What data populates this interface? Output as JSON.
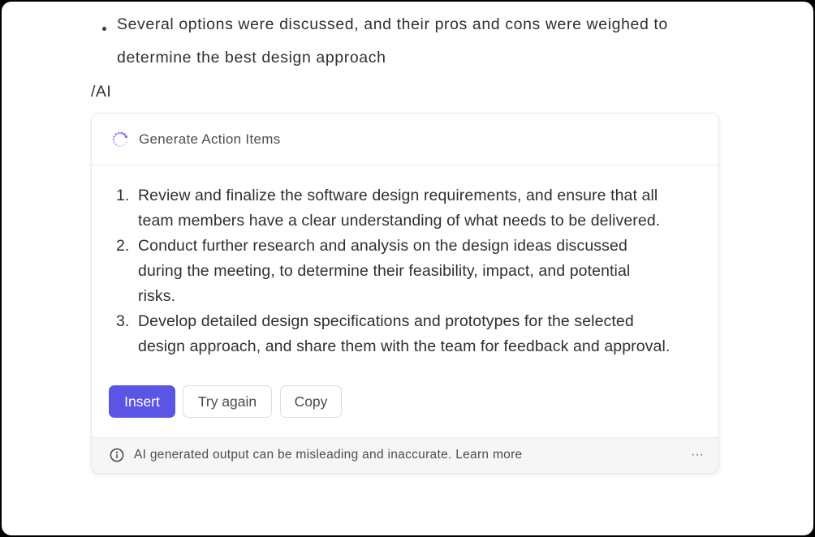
{
  "document": {
    "bullet_line_1": "Several options were discussed, and their pros and cons were weighed to",
    "bullet_line_2": "determine the best design approach",
    "ai_command": "/AI"
  },
  "ai_panel": {
    "title": "Generate Action Items",
    "items": [
      {
        "number": "1.",
        "lines": [
          "Review and finalize the software design requirements, and ensure that all",
          "team members have a clear understanding of what needs to be delivered."
        ]
      },
      {
        "number": "2.",
        "lines": [
          "Conduct further research and analysis on the design ideas discussed",
          "during the meeting, to determine their feasibility, impact, and potential",
          "risks."
        ]
      },
      {
        "number": "3.",
        "lines": [
          "Develop detailed design specifications and prototypes for the selected",
          "design approach, and share them with the team for feedback and approval."
        ]
      }
    ],
    "buttons": {
      "insert": "Insert",
      "try_again": "Try again",
      "copy": "Copy"
    },
    "footer": {
      "disclaimer": "AI generated output can be misleading and inaccurate. Learn more",
      "more": "···"
    }
  },
  "colors": {
    "accent": "#5b55e6",
    "spinner": "#6c63f0",
    "text": "#2f3033",
    "muted": "#4c4d52"
  },
  "icons": {
    "spinner": "loading-spinner-icon",
    "info": "info-circle-icon",
    "more": "more-horizontal-icon"
  }
}
